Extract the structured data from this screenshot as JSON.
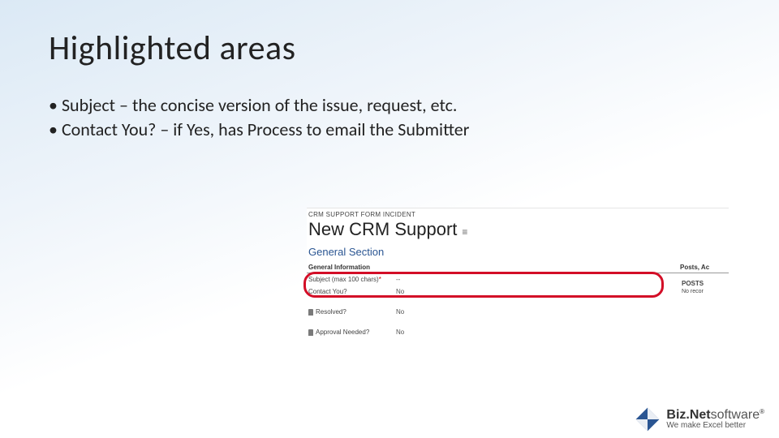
{
  "slide": {
    "title": "Highlighted areas",
    "bullets": [
      "Subject – the concise version of the issue, request, etc.",
      "Contact You? – if Yes, has Process to email the Submitter"
    ]
  },
  "crm": {
    "breadcrumb": "CRM SUPPORT FORM INCIDENT",
    "title": "New CRM Support",
    "section": "General Section",
    "subhead_left": "General Information",
    "subhead_right": "Posts, Ac",
    "fields": {
      "subject": {
        "label": "Subject (max 100 chars)",
        "required": "*",
        "value": "--"
      },
      "contact": {
        "label": "Contact You?",
        "value": "No"
      },
      "resolved": {
        "label": "Resolved?",
        "value": "No"
      },
      "approval": {
        "label": "Approval Needed?",
        "value": "No"
      }
    },
    "posts": {
      "header": "POSTS",
      "text": "No recor"
    }
  },
  "footer": {
    "brand_bold": "Biz.Net",
    "brand_light": "software",
    "reg": "®",
    "tagline": "We make Excel better"
  }
}
